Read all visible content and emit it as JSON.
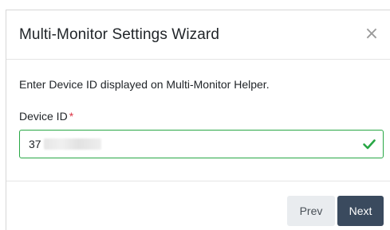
{
  "dialog": {
    "title": "Multi-Monitor Settings Wizard",
    "close_glyph": "×"
  },
  "body": {
    "instruction": "Enter Device ID displayed on Multi-Monitor Helper.",
    "field_label": "Device ID",
    "required_mark": "*",
    "input_value": "37",
    "validation_icon": "check-icon",
    "valid_color": "#28a745"
  },
  "footer": {
    "prev_label": "Prev",
    "next_label": "Next"
  },
  "colors": {
    "primary_button": "#3a4a5e",
    "secondary_button": "#e9ecef",
    "required": "#dc3545"
  }
}
